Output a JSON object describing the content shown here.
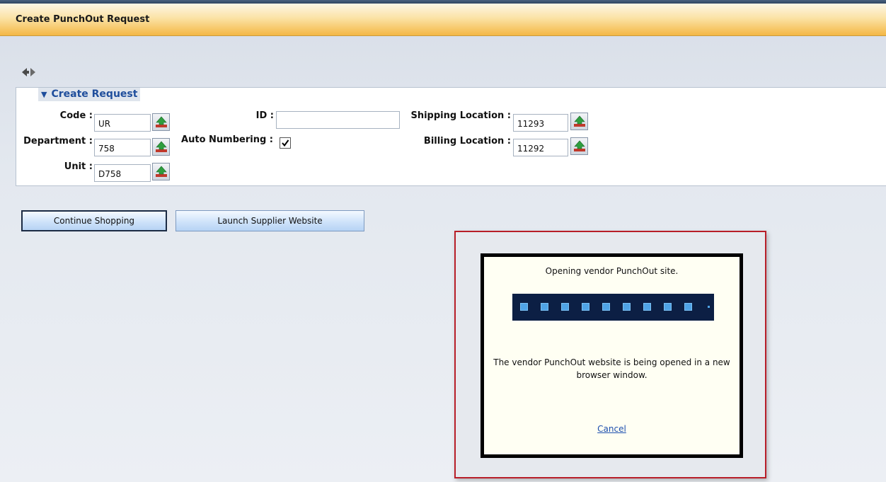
{
  "header": {
    "title": "Create PunchOut Request"
  },
  "nav": {
    "back_icon": "arrow-back-icon",
    "forward_icon": "arrow-forward-icon"
  },
  "section": {
    "title": "Create Request",
    "collapse_icon": "triangle-down-icon"
  },
  "form": {
    "code": {
      "label": "Code :",
      "value": "UR"
    },
    "department": {
      "label": "Department :",
      "value": "758"
    },
    "unit": {
      "label": "Unit :",
      "value": "D758"
    },
    "id": {
      "label": "ID :",
      "value": ""
    },
    "auto_numbering": {
      "label": "Auto Numbering :",
      "checked": true
    },
    "shipping_location": {
      "label": "Shipping Location :",
      "value": "11293"
    },
    "billing_location": {
      "label": "Billing Location :",
      "value": "11292"
    },
    "lookup_icon": "lookup-arrow-icon"
  },
  "buttons": {
    "continue_shopping": "Continue Shopping",
    "launch_supplier_website": "Launch Supplier Website"
  },
  "dialog": {
    "title": "Opening vendor PunchOut site.",
    "message": "The vendor PunchOut website is being opened in a new browser window.",
    "cancel_label": "Cancel",
    "progress_segments_filled": 9
  },
  "colors": {
    "header_accent": "#f4b745",
    "section_title": "#1f4e9c",
    "progress_bg": "#0c1f44",
    "progress_fill": "#4fa3e6",
    "highlight_border": "#b81e28",
    "link": "#1d4fae"
  }
}
